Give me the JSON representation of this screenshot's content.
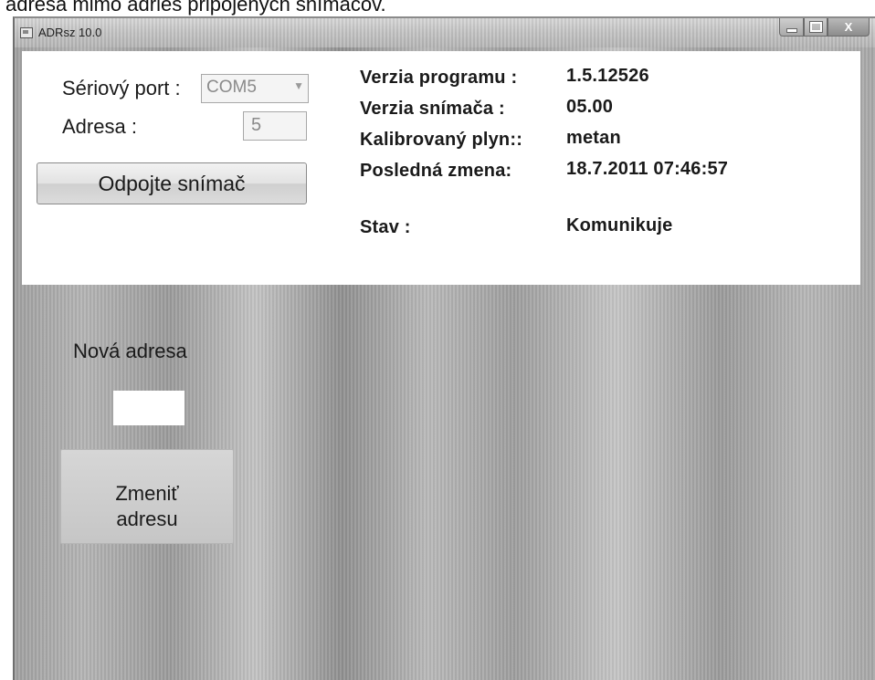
{
  "caption": "adresa mimo adries pripojených snímačov.",
  "window": {
    "title": "ADRsz 10.0",
    "close_label": "X"
  },
  "connection": {
    "serial_port_label": "Sériový port :",
    "serial_port_value": "COM5",
    "address_label": "Adresa :",
    "address_value": "5",
    "disconnect_button": "Odpojte snímač"
  },
  "info": {
    "program_version_label": "Verzia programu :",
    "program_version_value": "1.5.12526",
    "sensor_version_label": "Verzia snímača :",
    "sensor_version_value": "05.00",
    "gas_label": "Kalibrovaný plyn::",
    "gas_value": "metan",
    "last_change_label": "Posledná zmena:",
    "last_change_value": "18.7.2011 07:46:57",
    "status_label": "Stav :",
    "status_value": "Komunikuje"
  },
  "new_address": {
    "label": "Nová adresa",
    "value": "",
    "change_button": "Zmeniť\nadresu"
  }
}
